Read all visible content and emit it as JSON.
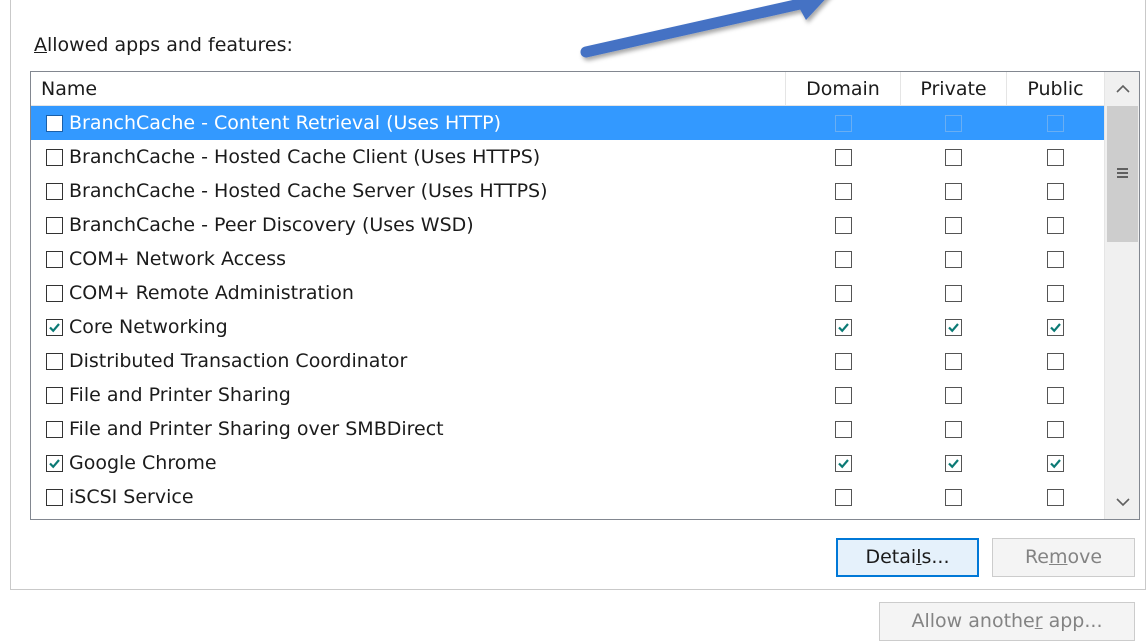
{
  "group_label": {
    "first_letter": "A",
    "rest": "llowed apps and features:"
  },
  "columns": {
    "name": "Name",
    "domain": "Domain",
    "private": "Private",
    "public": "Public"
  },
  "rows": [
    {
      "label": "BranchCache - Content Retrieval (Uses HTTP)",
      "enabled": false,
      "domain": false,
      "private": false,
      "public": false,
      "selected": true
    },
    {
      "label": "BranchCache - Hosted Cache Client (Uses HTTPS)",
      "enabled": false,
      "domain": false,
      "private": false,
      "public": false,
      "selected": false
    },
    {
      "label": "BranchCache - Hosted Cache Server (Uses HTTPS)",
      "enabled": false,
      "domain": false,
      "private": false,
      "public": false,
      "selected": false
    },
    {
      "label": "BranchCache - Peer Discovery (Uses WSD)",
      "enabled": false,
      "domain": false,
      "private": false,
      "public": false,
      "selected": false
    },
    {
      "label": "COM+ Network Access",
      "enabled": false,
      "domain": false,
      "private": false,
      "public": false,
      "selected": false
    },
    {
      "label": "COM+ Remote Administration",
      "enabled": false,
      "domain": false,
      "private": false,
      "public": false,
      "selected": false
    },
    {
      "label": "Core Networking",
      "enabled": true,
      "domain": true,
      "private": true,
      "public": true,
      "selected": false
    },
    {
      "label": "Distributed Transaction Coordinator",
      "enabled": false,
      "domain": false,
      "private": false,
      "public": false,
      "selected": false
    },
    {
      "label": "File and Printer Sharing",
      "enabled": false,
      "domain": false,
      "private": false,
      "public": false,
      "selected": false
    },
    {
      "label": "File and Printer Sharing over SMBDirect",
      "enabled": false,
      "domain": false,
      "private": false,
      "public": false,
      "selected": false
    },
    {
      "label": "Google Chrome",
      "enabled": true,
      "domain": true,
      "private": true,
      "public": true,
      "selected": false
    },
    {
      "label": "iSCSI Service",
      "enabled": false,
      "domain": false,
      "private": false,
      "public": false,
      "selected": false
    }
  ],
  "buttons": {
    "details": {
      "pre": "Detai",
      "ul": "l",
      "post": "s..."
    },
    "remove": {
      "pre": "Re",
      "ul": "m",
      "post": "ove"
    },
    "allow": {
      "pre": "Allow anothe",
      "ul": "r",
      "post": " app..."
    }
  },
  "scrollbar": {
    "up_icon": "chevron-up-icon",
    "down_icon": "chevron-down-icon",
    "grip_icon": "grip-icon"
  },
  "colors": {
    "selection": "#3399ff",
    "annotation_arrow": "#4472c4",
    "check": "#0b7a75",
    "focus_border": "#0078d7"
  }
}
